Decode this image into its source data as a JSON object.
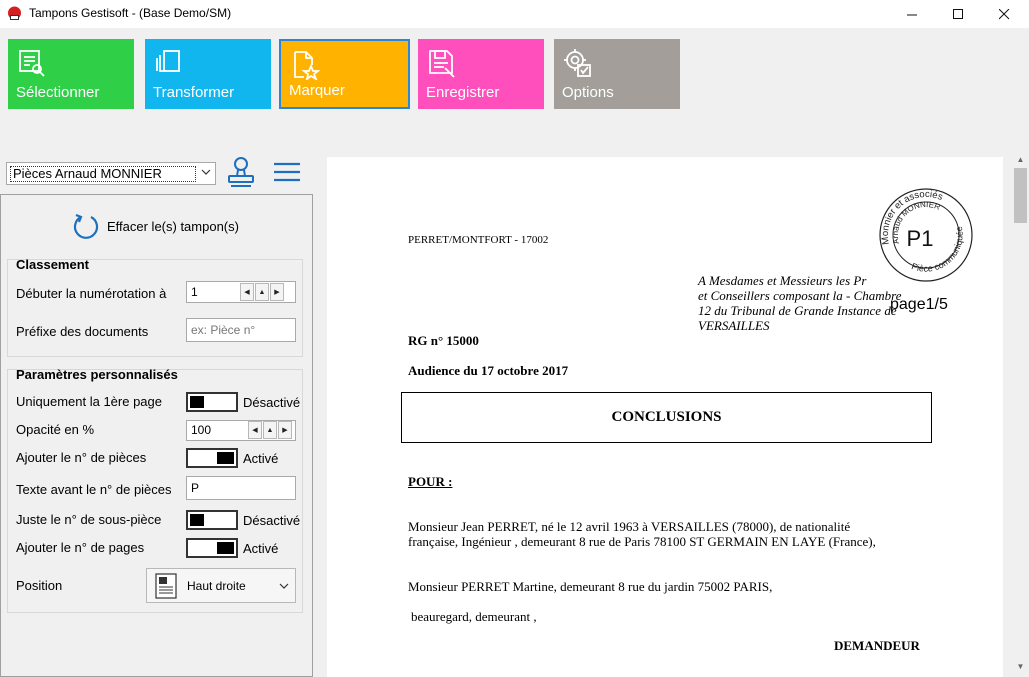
{
  "window": {
    "title": "Tampons Gestisoft - (Base Demo/SM)",
    "min_symbol": "—",
    "max_symbol": "☐",
    "close_symbol": "✕"
  },
  "ribbon": {
    "select_label": "Sélectionner",
    "transform_label": "Transformer",
    "mark_label": "Marquer",
    "save_label": "Enregistrer",
    "options_label": "Options",
    "colors": {
      "select": "#2fd048",
      "transform": "#11b6ee",
      "mark": "#ffb300",
      "save": "#ff4fbd",
      "options": "#a39e99",
      "active_border": "#2a86d6"
    }
  },
  "toolbar": {
    "profile_value": "Pièces Arnaud MONNIER",
    "stamp_icon": "stamp-icon",
    "menu_icon": "hamburger-menu-icon"
  },
  "panel": {
    "clear_label": "Effacer le(s) tampon(s)",
    "classement": {
      "title": "Classement",
      "start_label": "Débuter la numérotation à",
      "start_value": "1",
      "prefix_label": "Préfixe des documents",
      "prefix_placeholder": "ex: Pièce n°"
    },
    "params": {
      "title": "Paramètres personnalisés",
      "first_page_label": "Uniquement la 1ère page",
      "first_page_state": "Désactivé",
      "opacity_label": "Opacité en %",
      "opacity_value": "100",
      "add_piece_label": "Ajouter le n° de pièces",
      "add_piece_state": "Activé",
      "text_before_label": "Texte avant le n° de pièces",
      "text_before_value": "P",
      "sub_piece_label": "Juste le n° de sous-pièce",
      "sub_piece_state": "Désactivé",
      "add_pages_label": "Ajouter le n° de pages",
      "add_pages_state": "Activé",
      "position_label": "Position",
      "position_value": "Haut droite"
    }
  },
  "document": {
    "reference": "PERRET/MONTFORT - 17002",
    "address_lines": [
      "A Mesdames et Messieurs les Pr",
      "et Conseillers composant la - Chambre",
      "12 du Tribunal de Grande Instance de",
      "VERSAILLES"
    ],
    "rg": "RG n° 15000",
    "audience": "Audience du 17 octobre 2017",
    "conclusions": "CONCLUSIONS",
    "pour": "POUR :",
    "para1_line1": "Monsieur Jean  PERRET, né le 12 avril 1963 à VERSAILLES (78000), de nationalité",
    "para1_line2": "française, Ingénieur , demeurant 8 rue de Paris  78100 ST GERMAIN EN LAYE (France),",
    "para2": "Monsieur PERRET Martine, demeurant 8 rue du jardin 75002 PARIS,",
    "para3": "beauregard, demeurant ,",
    "demandeur": "DEMANDEUR",
    "stamp": {
      "top_text": "Monnier et associés",
      "inner_text": "Arnaud MONNIER",
      "center_text": "P1",
      "bottom_text": "Pièce communiquée"
    },
    "page_label": "page1/5"
  }
}
